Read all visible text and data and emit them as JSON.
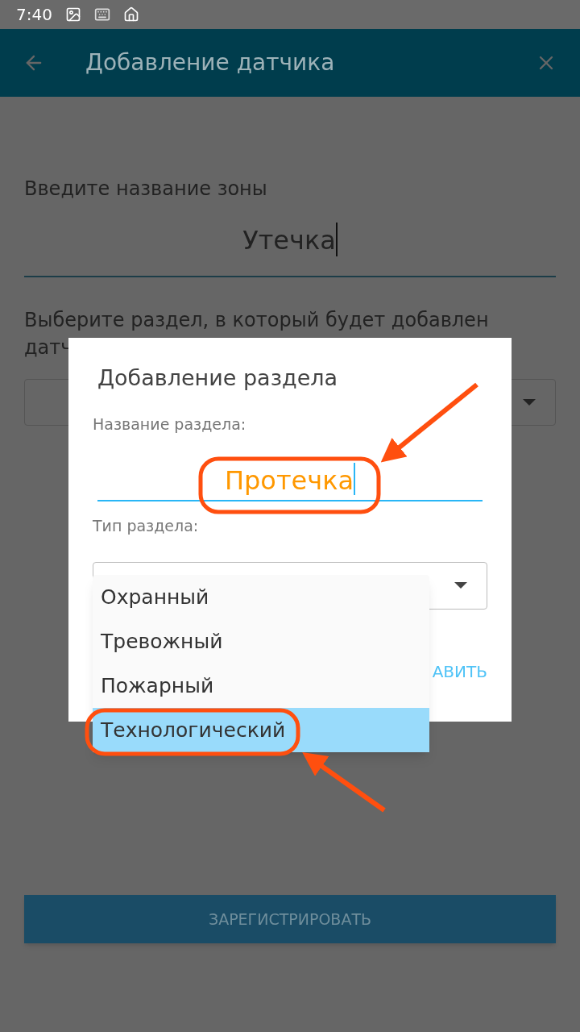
{
  "status_bar": {
    "time": "7:40"
  },
  "app_bar": {
    "title": "Добавление датчика"
  },
  "zone_label": "Введите название зоны",
  "zone_field": {
    "value": "Утечка"
  },
  "section_prompt_lines": [
    "Выберите раздел, в который будет добавлен",
    "датч"
  ],
  "register_button": "ЗАРЕГИСТРИРОВАТЬ",
  "dialog": {
    "title": "Добавление раздела",
    "name_label": "Название раздела:",
    "name_field": {
      "value": "Протечка"
    },
    "type_label": "Тип раздела:",
    "action_visible": "АВИТЬ"
  },
  "dropdown": [
    {
      "label": "Охранный",
      "selected": false
    },
    {
      "label": "Тревожный",
      "selected": false
    },
    {
      "label": "Пожарный",
      "selected": false
    },
    {
      "label": "Технологический",
      "selected": true
    }
  ]
}
